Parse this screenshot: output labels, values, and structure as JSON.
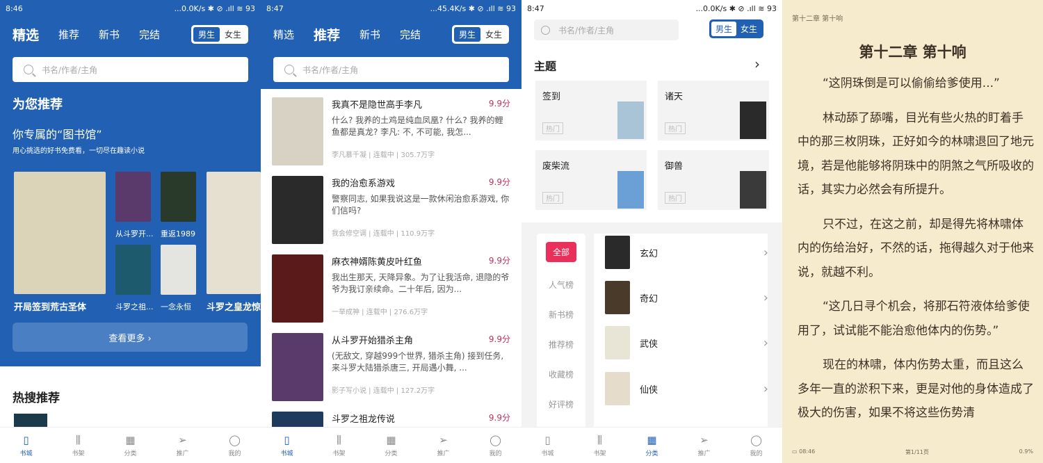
{
  "screen1": {
    "status": {
      "time": "8:46",
      "right": "...0.0K/s ✱ ⊘ .ıll ≋ 93"
    },
    "tabs": [
      "精选",
      "推荐",
      "新书",
      "完结"
    ],
    "gender": {
      "male": "男生",
      "female": "女生"
    },
    "search_placeholder": "书名/作者/主角",
    "section_title": "为您推荐",
    "library_title": "你专属的“图书馆”",
    "library_sub": "用心挑选的好书免费看，一切尽在趣读小说",
    "books": [
      {
        "title": "开局签到荒古圣体",
        "cover_text": "荒古圣体",
        "color": "#dcd4b8"
      },
      {
        "title": "从斗罗开...",
        "cover_text": "从斗罗开始猎杀主角",
        "color": "#5a3a6a"
      },
      {
        "title": "重返1989",
        "cover_text": "重返1989",
        "color": "#2a3a2a"
      },
      {
        "title": "斗罗之祖...",
        "cover_text": "斗罗之祖龙",
        "color": "#1e5a6e"
      },
      {
        "title": "一念永恒",
        "cover_text": "一念永恒",
        "color": "#e4e4e0"
      },
      {
        "title": "斗罗之皇龙惊",
        "cover_text": "斗罗之皇龙惊世",
        "color": "#e6e0d0"
      }
    ],
    "more_button": "查看更多 ›",
    "hot_title": "热搜推荐"
  },
  "screen2": {
    "status": {
      "time": "8:47",
      "right": "...45.4K/s ✱ ⊘ .ıll ≋ 93"
    },
    "books": [
      {
        "title": "我真不是隐世高手李凡",
        "score": "9.9分",
        "desc": "什么? 我养的土鸡是纯血凤凰? 什么? 我养的鲤鱼都是真龙? 李凡: 不, 不可能, 我怎...",
        "meta": "李凡慕千凝 | 连载中 | 305.7万字",
        "color": "#d8d2c4"
      },
      {
        "title": "我的治愈系游戏",
        "score": "9.9分",
        "desc": "警察同志, 如果我说这是一款休闲治愈系游戏, 你们信吗?",
        "meta": "我会修空调 | 连载中 | 110.9万字",
        "color": "#2a2a2a"
      },
      {
        "title": "麻衣神婿陈黄皮叶红鱼",
        "score": "9.9分",
        "desc": "我出生那天, 天降异象。为了让我活命, 退隐的爷爷为我订亲续命。二十年后, 因为...",
        "meta": "一举成神 | 连载中 | 276.6万字",
        "color": "#5a1a1a"
      },
      {
        "title": "从斗罗开始猎杀主角",
        "score": "9.9分",
        "desc": "(无敌文, 穿越999个世界, 猎杀主角) 接到任务, 来斗罗大陆猎杀唐三, 开局遇小舞, ...",
        "meta": "影子写小说 | 连载中 | 127.2万字",
        "color": "#5a3a6a"
      },
      {
        "title": "斗罗之祖龙传说",
        "score": "9.9分",
        "desc": "",
        "meta": "",
        "color": "#1e3a5e"
      }
    ]
  },
  "screen3": {
    "status": {
      "time": "8:47",
      "right": "...0.0K/s ✱ ⊘ .ıll ≋ 93"
    },
    "topics_title": "主题",
    "topics": [
      {
        "name": "签到",
        "badge": "热门"
      },
      {
        "name": "诸天",
        "badge": "热门"
      },
      {
        "name": "废柴流",
        "badge": "热门"
      },
      {
        "name": "御兽",
        "badge": "热门"
      }
    ],
    "rail": [
      "全部",
      "人气榜",
      "新书榜",
      "推荐榜",
      "收藏榜",
      "好评榜"
    ],
    "categories": [
      "玄幻",
      "奇幻",
      "武侠",
      "仙侠"
    ]
  },
  "nav": [
    "书城",
    "书架",
    "分类",
    "推广",
    "我的"
  ],
  "reader": {
    "header": "第十二章 第十响",
    "chapter_title": "第十二章 第十响",
    "paragraphs": [
      "“这阴珠倒是可以偷偷给爹使用...”",
      "林动舔了舔嘴，目光有些火热的盯着手中的那三枚阴珠，正好如今的林啸退回了地元境，若是他能够将阴珠中的阴煞之气所吸收的话，其实力必然会有所提升。",
      "只不过，在这之前，却是得先将林啸体内的伤给治好，不然的话，拖得越久对于他来说，就越不利。",
      "“这几日寻个机会，将那石符液体给爹使用了，试试能不能治愈他体内的伤势。”",
      "现在的林啸，体内伤势太重，而且这么多年一直的淤积下来，更是对他的身体造成了极大的伤害，如果不将这些伤势清"
    ],
    "footer": {
      "time": "08:46",
      "page": "第1/11页",
      "progress": "0.9%"
    }
  }
}
